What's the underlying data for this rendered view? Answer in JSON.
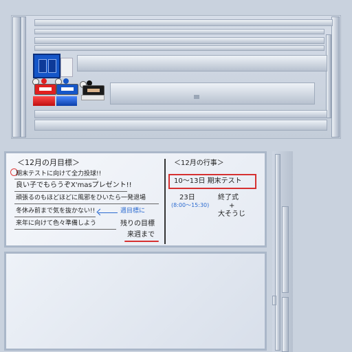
{
  "board": {
    "left_title": "＜12月の月目標＞",
    "goals": [
      "期末テストに向けて全力投球!!",
      "良い子でもらうぞX'masプレゼント!!",
      "頑張るのもほどほどに風邪をひいたら一発退場",
      "冬休み前まで気を抜かない!!",
      "来年に向けて色々準備しよう"
    ],
    "note_line1": "週目標に",
    "note_line2": "残りの目標",
    "note_line3": "来週まで",
    "right_title": "＜12月の行事＞",
    "event1": "10〜13日 期末テスト",
    "event2_date": "23日",
    "event2_time": "(8:00〜15:30)",
    "event2_line1": "終了式",
    "event2_plus": "+",
    "event2_line2": "大そうじ"
  },
  "colors": {
    "marker_blue": "#1556c8",
    "marker_red": "#e02020",
    "accent_red": "#d63030",
    "accent_blue": "#2a6ad0"
  }
}
